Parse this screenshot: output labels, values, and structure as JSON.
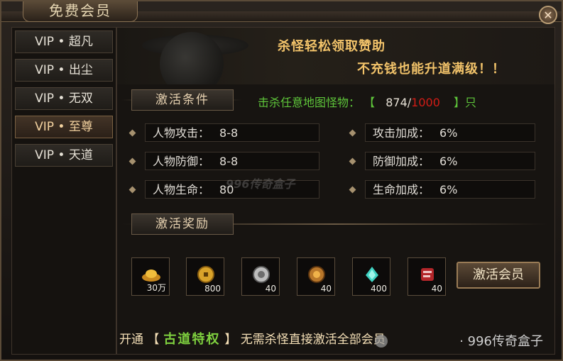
{
  "window": {
    "title": "免费会员",
    "close_glyph": "✕"
  },
  "sidebar": {
    "items": [
      {
        "label": "VIP • 超凡",
        "active": false
      },
      {
        "label": "VIP • 出尘",
        "active": false
      },
      {
        "label": "VIP • 无双",
        "active": false
      },
      {
        "label": "VIP • 至尊",
        "active": true
      },
      {
        "label": "VIP • 天道",
        "active": false
      }
    ]
  },
  "banner": {
    "line1": "杀怪轻松领取赞助",
    "line2": "不充钱也能升道满级！！"
  },
  "conditions": {
    "header": "激活条件",
    "kill_label": "击杀任意地图怪物：",
    "open_bracket": "【",
    "current": "874",
    "separator": "/",
    "required": "1000",
    "close_bracket": "】只",
    "stats_left": [
      {
        "label": "人物攻击：",
        "value": "8-8"
      },
      {
        "label": "人物防御：",
        "value": "8-8"
      },
      {
        "label": "人物生命：",
        "value": "80"
      }
    ],
    "stats_right": [
      {
        "label": "攻击加成：",
        "value": "6%"
      },
      {
        "label": "防御加成：",
        "value": "6%"
      },
      {
        "label": "生命加成：",
        "value": "6%"
      }
    ]
  },
  "rewards": {
    "header": "激活奖励",
    "items": [
      {
        "icon": "gold-ingot-icon",
        "count": "30万"
      },
      {
        "icon": "gold-coin-icon",
        "count": "800"
      },
      {
        "icon": "silver-medal-icon",
        "count": "40"
      },
      {
        "icon": "bronze-medal-icon",
        "count": "40"
      },
      {
        "icon": "jade-crystal-icon",
        "count": "400"
      },
      {
        "icon": "red-scroll-icon",
        "count": "40"
      }
    ],
    "activate_label": "激活会员"
  },
  "footer": {
    "prefix": "开通",
    "open_bracket": "【",
    "special": "古道特权",
    "close_bracket": "】",
    "suffix": "无需杀怪直接激活全部会员"
  },
  "watermarks": {
    "center": "996传奇盒子",
    "brand": "· 996传奇盒子"
  },
  "colors": {
    "accent_gold": "#f2c36a",
    "kill_green": "#5ec53a",
    "required_red": "#d21c16",
    "special_green": "#7fd13f"
  }
}
